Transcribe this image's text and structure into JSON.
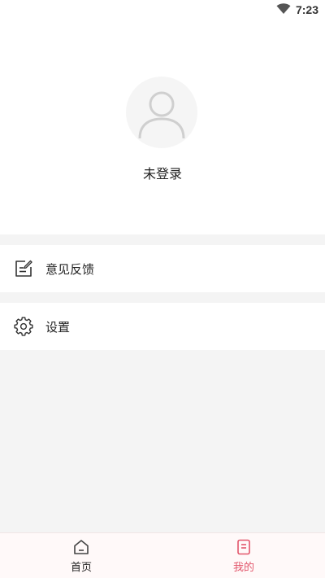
{
  "status_bar": {
    "time": "7:23",
    "icons": [
      "wifi-icon"
    ]
  },
  "profile": {
    "avatar_icon": "default-avatar-icon",
    "login_status": "未登录"
  },
  "menu": {
    "items": [
      {
        "label": "意见反馈",
        "icon": "feedback-edit-icon"
      },
      {
        "label": "设置",
        "icon": "gear-icon"
      }
    ]
  },
  "bottom_nav": {
    "items": [
      {
        "label": "首页",
        "icon": "home-icon",
        "active": false
      },
      {
        "label": "我的",
        "icon": "document-icon",
        "active": true
      }
    ]
  },
  "colors": {
    "accent": "#e2566b",
    "background": "#f4f4f4",
    "nav_background": "#fff9f9",
    "text": "#222222",
    "avatar_bg": "#f5f5f5"
  }
}
